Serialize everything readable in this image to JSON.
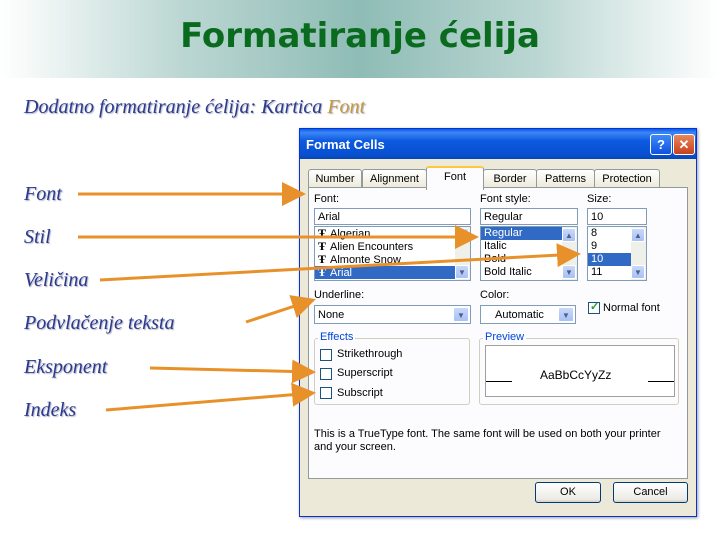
{
  "slide": {
    "title": "Formatiranje ćelija",
    "subtitle_main": "Dodatno formatiranje ćelija: Kartica ",
    "subtitle_accent": "Font",
    "labels": [
      "Font",
      "Stil",
      "Veličina",
      "Podvlačenje teksta",
      "Eksponent",
      "Indeks"
    ]
  },
  "colors": {
    "title": "#0a6b1e",
    "label": "#2b3a8c",
    "arrow": "#e8912a",
    "accent": "#c49a3a"
  },
  "dialog": {
    "title": "Format Cells",
    "help_icon": "?",
    "close_icon": "✕",
    "tabs": [
      "Number",
      "Alignment",
      "Font",
      "Border",
      "Patterns",
      "Protection"
    ],
    "active_tab": "Font",
    "font_label": "Font:",
    "font_value": "Arial",
    "font_list": [
      "Algerian",
      "Alien Encounters",
      "Almonte Snow",
      "Arial"
    ],
    "font_selected": "Arial",
    "style_label": "Font style:",
    "style_value": "Regular",
    "style_list": [
      "Regular",
      "Italic",
      "Bold",
      "Bold Italic"
    ],
    "style_selected": "Regular",
    "size_label": "Size:",
    "size_value": "10",
    "size_list": [
      "8",
      "9",
      "10",
      "11"
    ],
    "size_selected": "10",
    "underline_label": "Underline:",
    "underline_value": "None",
    "color_label": "Color:",
    "color_value": "Automatic",
    "normal_font_label": "Normal font",
    "normal_font_checked": true,
    "effects_label": "Effects",
    "strikethrough_label": "Strikethrough",
    "superscript_label": "Superscript",
    "subscript_label": "Subscript",
    "preview_label": "Preview",
    "preview_text": "AaBbCcYyZz",
    "info_line1": "This is a TrueType font.  The same font will be used on both your printer",
    "info_line2": "and your screen.",
    "ok_label": "OK",
    "cancel_label": "Cancel"
  }
}
